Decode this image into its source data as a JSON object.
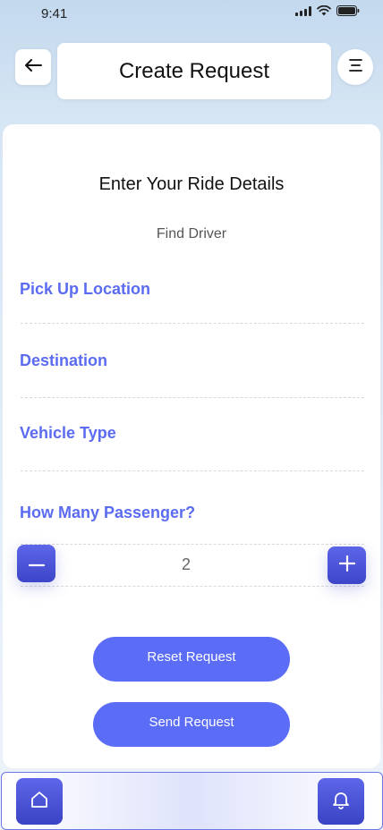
{
  "status_bar": {
    "time": "9:41"
  },
  "header": {
    "title": "Create Request"
  },
  "form": {
    "heading": "Enter Your Ride Details",
    "subheading": "Find Driver",
    "pickup_label": "Pick Up Location",
    "destination_label": "Destination",
    "vehicle_label": "Vehicle Type",
    "passenger_label": "How Many Passenger?",
    "passenger_count": "2"
  },
  "actions": {
    "reset_label": "Reset Request",
    "send_label": "Send Request"
  },
  "icons": {
    "back": "arrow-left-icon",
    "menu": "menu-icon",
    "minus": "minus-icon",
    "plus": "plus-icon",
    "home": "home-icon",
    "bell": "bell-icon"
  },
  "colors": {
    "accent": "#5b6cf0",
    "button": "#5b6cf6",
    "icon_button": "#4a52d6"
  }
}
